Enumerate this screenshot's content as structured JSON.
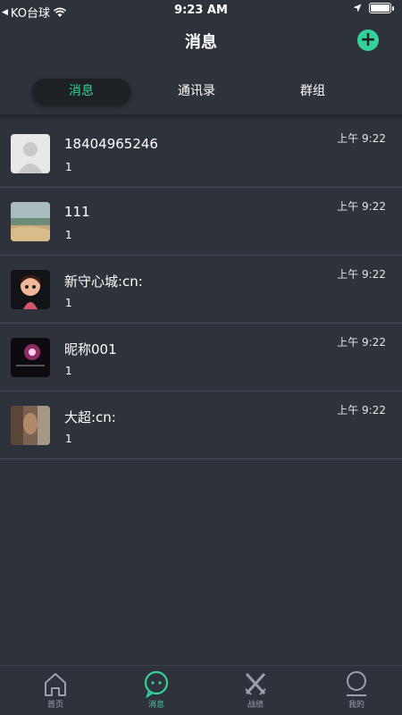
{
  "status_bar": {
    "carrier": "KO台球",
    "back_glyph": "◀",
    "time": "9:23 AM"
  },
  "header": {
    "title": "消息",
    "add_icon": "+"
  },
  "tabs": [
    {
      "label": "消息",
      "active": true
    },
    {
      "label": "通讯录",
      "active": false
    },
    {
      "label": "群组",
      "active": false
    }
  ],
  "conversations": [
    {
      "name": "18404965246",
      "last_message": "1",
      "time": "上午 9:22",
      "avatar": "default-person-avatar"
    },
    {
      "name": "111",
      "last_message": "1",
      "time": "上午 9:22",
      "avatar": "beach-photo-avatar"
    },
    {
      "name": "新守心城:cn:",
      "last_message": "1",
      "time": "上午 9:22",
      "avatar": "cartoon-girl-avatar"
    },
    {
      "name": "昵称001",
      "last_message": "1",
      "time": "上午 9:22",
      "avatar": "light-photo-avatar"
    },
    {
      "name": "大超:cn:",
      "last_message": "1",
      "time": "上午 9:22",
      "avatar": "portrait-photo-avatar"
    }
  ],
  "tabbar": [
    {
      "label": "首页",
      "icon": "home-icon",
      "active": false
    },
    {
      "label": "消息",
      "icon": "chat-bubble-icon",
      "active": true
    },
    {
      "label": "战绩",
      "icon": "crossed-swords-icon",
      "active": false
    },
    {
      "label": "我的",
      "icon": "profile-icon",
      "active": false
    }
  ],
  "colors": {
    "accent": "#33d29a",
    "background": "#2e323b",
    "active_tab_bg": "#1d2126"
  }
}
